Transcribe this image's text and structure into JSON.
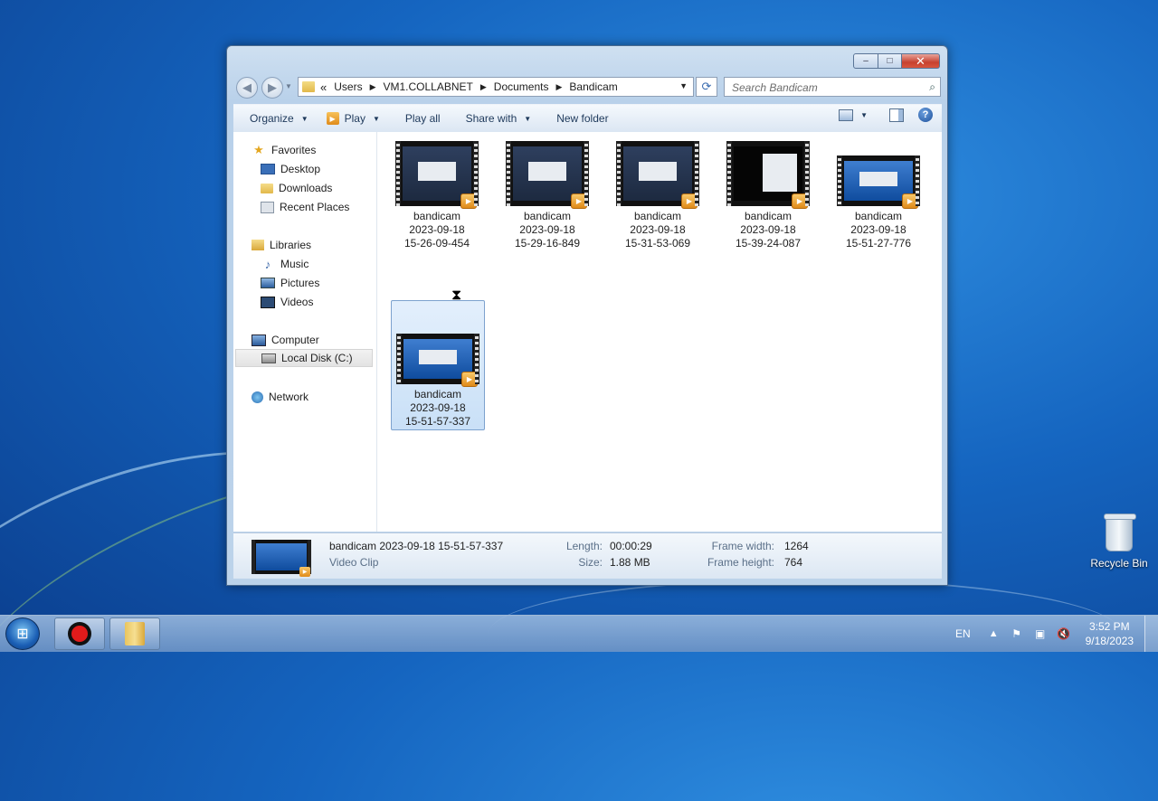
{
  "window": {
    "caption_buttons": {
      "minimize": "–",
      "maximize": "□",
      "close": "✕"
    },
    "address": {
      "lead": "«",
      "crumbs": [
        "Users",
        "VM1.COLLABNET",
        "Documents",
        "Bandicam"
      ]
    },
    "search_placeholder": "Search Bandicam",
    "toolbar": {
      "organize": "Organize",
      "play": "Play",
      "play_all": "Play all",
      "share_with": "Share with",
      "new_folder": "New folder"
    },
    "nav": {
      "favorites": "Favorites",
      "desktop": "Desktop",
      "downloads": "Downloads",
      "recent_places": "Recent Places",
      "libraries": "Libraries",
      "music": "Music",
      "pictures": "Pictures",
      "videos": "Videos",
      "computer": "Computer",
      "local_disk": "Local Disk (C:)",
      "network": "Network"
    },
    "files": [
      {
        "l1": "bandicam",
        "l2": "2023-09-18",
        "l3": "15-26-09-454"
      },
      {
        "l1": "bandicam",
        "l2": "2023-09-18",
        "l3": "15-29-16-849"
      },
      {
        "l1": "bandicam",
        "l2": "2023-09-18",
        "l3": "15-31-53-069"
      },
      {
        "l1": "bandicam",
        "l2": "2023-09-18",
        "l3": "15-39-24-087"
      },
      {
        "l1": "bandicam",
        "l2": "2023-09-18",
        "l3": "15-51-27-776"
      },
      {
        "l1": "bandicam",
        "l2": "2023-09-18",
        "l3": "15-51-57-337"
      }
    ],
    "details": {
      "name": "bandicam 2023-09-18 15-51-57-337",
      "type": "Video Clip",
      "length_label": "Length:",
      "length": "00:00:29",
      "size_label": "Size:",
      "size": "1.88 MB",
      "frame_width_label": "Frame width:",
      "frame_width": "1264",
      "frame_height_label": "Frame height:",
      "frame_height": "764"
    }
  },
  "desktop": {
    "recycle_bin": "Recycle Bin"
  },
  "taskbar": {
    "lang": "EN",
    "time": "3:52 PM",
    "date": "9/18/2023"
  }
}
